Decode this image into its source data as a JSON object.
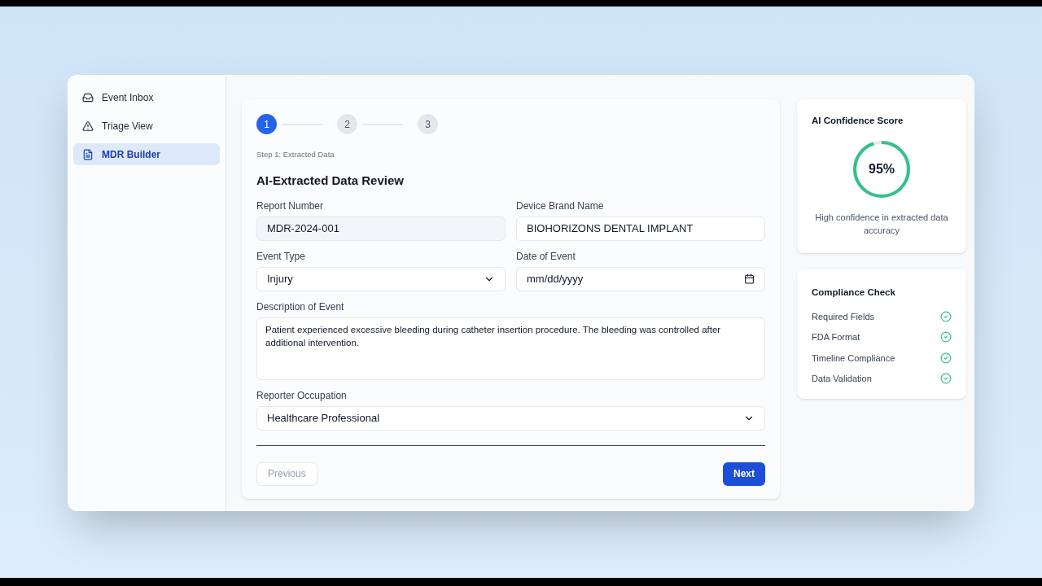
{
  "sidebar": {
    "items": [
      {
        "label": "Event Inbox",
        "selected": false
      },
      {
        "label": "Triage View",
        "selected": false
      },
      {
        "label": "MDR Builder",
        "selected": true
      }
    ]
  },
  "stepper": {
    "steps": [
      {
        "label": "1",
        "selected": true
      },
      {
        "label": "2",
        "selected": false
      },
      {
        "label": "3",
        "selected": false
      }
    ],
    "caption": "Step 1: Extracted Data"
  },
  "form": {
    "title": "AI-Extracted Data Review",
    "fields": [
      {
        "label": "Report Number",
        "kind": "text",
        "value": "MDR-2024-001",
        "disabled": true
      },
      {
        "label": "Device Brand Name",
        "kind": "text",
        "value": "BIOHORIZONS DENTAL IMPLANT",
        "disabled": false
      },
      {
        "label": "Event Type",
        "kind": "select",
        "value": "Injury",
        "disabled": false
      },
      {
        "label": "Date of Event",
        "kind": "date",
        "placeholder": "mm/dd/yyyy",
        "disabled": false
      },
      {
        "label": "Description of Event",
        "kind": "textarea",
        "value": "Patient experienced excessive bleeding during catheter insertion procedure. The bleeding was controlled after additional intervention.",
        "disabled": false
      },
      {
        "label": "Reporter Occupation",
        "kind": "select",
        "value": "Healthcare Professional",
        "disabled": false
      }
    ],
    "buttons": [
      {
        "label": "Previous",
        "disabled": true
      },
      {
        "label": "Next",
        "disabled": false
      }
    ]
  },
  "confidence": {
    "title": "AI Confidence Score",
    "reading": "95%",
    "level": 0.95,
    "caption": "High confidence in extracted data accuracy"
  },
  "compliance": {
    "title": "Compliance Check",
    "items": [
      {
        "label": "Required Fields",
        "checked": true
      },
      {
        "label": "FDA Format",
        "checked": true
      },
      {
        "label": "Timeline Compliance",
        "checked": true
      },
      {
        "label": "Data Validation",
        "checked": true
      }
    ]
  }
}
